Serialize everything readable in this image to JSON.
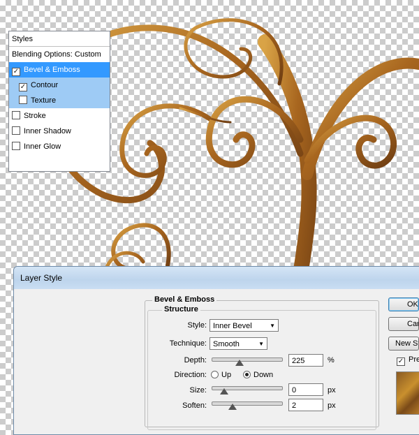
{
  "dialog": {
    "title": "Layer Style",
    "styles_list": {
      "header": "Styles",
      "items": [
        {
          "label": "Blending Options: Custom",
          "checkbox": false,
          "checked": false,
          "state": "normal"
        },
        {
          "label": "Bevel & Emboss",
          "checkbox": true,
          "checked": true,
          "state": "selected"
        },
        {
          "label": "Contour",
          "checkbox": true,
          "checked": true,
          "state": "sub"
        },
        {
          "label": "Texture",
          "checkbox": true,
          "checked": false,
          "state": "sub"
        },
        {
          "label": "Stroke",
          "checkbox": true,
          "checked": false,
          "state": "normal"
        },
        {
          "label": "Inner Shadow",
          "checkbox": true,
          "checked": false,
          "state": "normal"
        },
        {
          "label": "Inner Glow",
          "checkbox": true,
          "checked": false,
          "state": "normal"
        }
      ]
    },
    "panel": {
      "title": "Bevel & Emboss",
      "section": "Structure",
      "style_label": "Style:",
      "style_value": "Inner Bevel",
      "technique_label": "Technique:",
      "technique_value": "Smooth",
      "depth_label": "Depth:",
      "depth_value": "225",
      "depth_unit": "%",
      "depth_level": 0.22,
      "direction_label": "Direction:",
      "direction_up": "Up",
      "direction_down": "Down",
      "direction_selected": "Down",
      "size_label": "Size:",
      "size_value": "0",
      "size_unit": "px",
      "size_level": 0.0,
      "soften_label": "Soften:",
      "soften_value": "2",
      "soften_unit": "px",
      "soften_level": 0.12
    },
    "buttons": {
      "ok": "OK",
      "cancel": "Cancel",
      "new_style": "New Style...",
      "preview": "Preview"
    },
    "preview_checked": true
  },
  "colors": {
    "selection": "#3399ff",
    "sub_selection": "#9ecbf5",
    "swirl_dark": "#6e3d12",
    "swirl_mid": "#a8661f",
    "swirl_light": "#d9a346"
  },
  "icons": [
    "checkbox-checked-icon",
    "checkbox-unchecked-icon",
    "dropdown-arrow-icon",
    "slider-thumb-icon",
    "radio-icon"
  ]
}
